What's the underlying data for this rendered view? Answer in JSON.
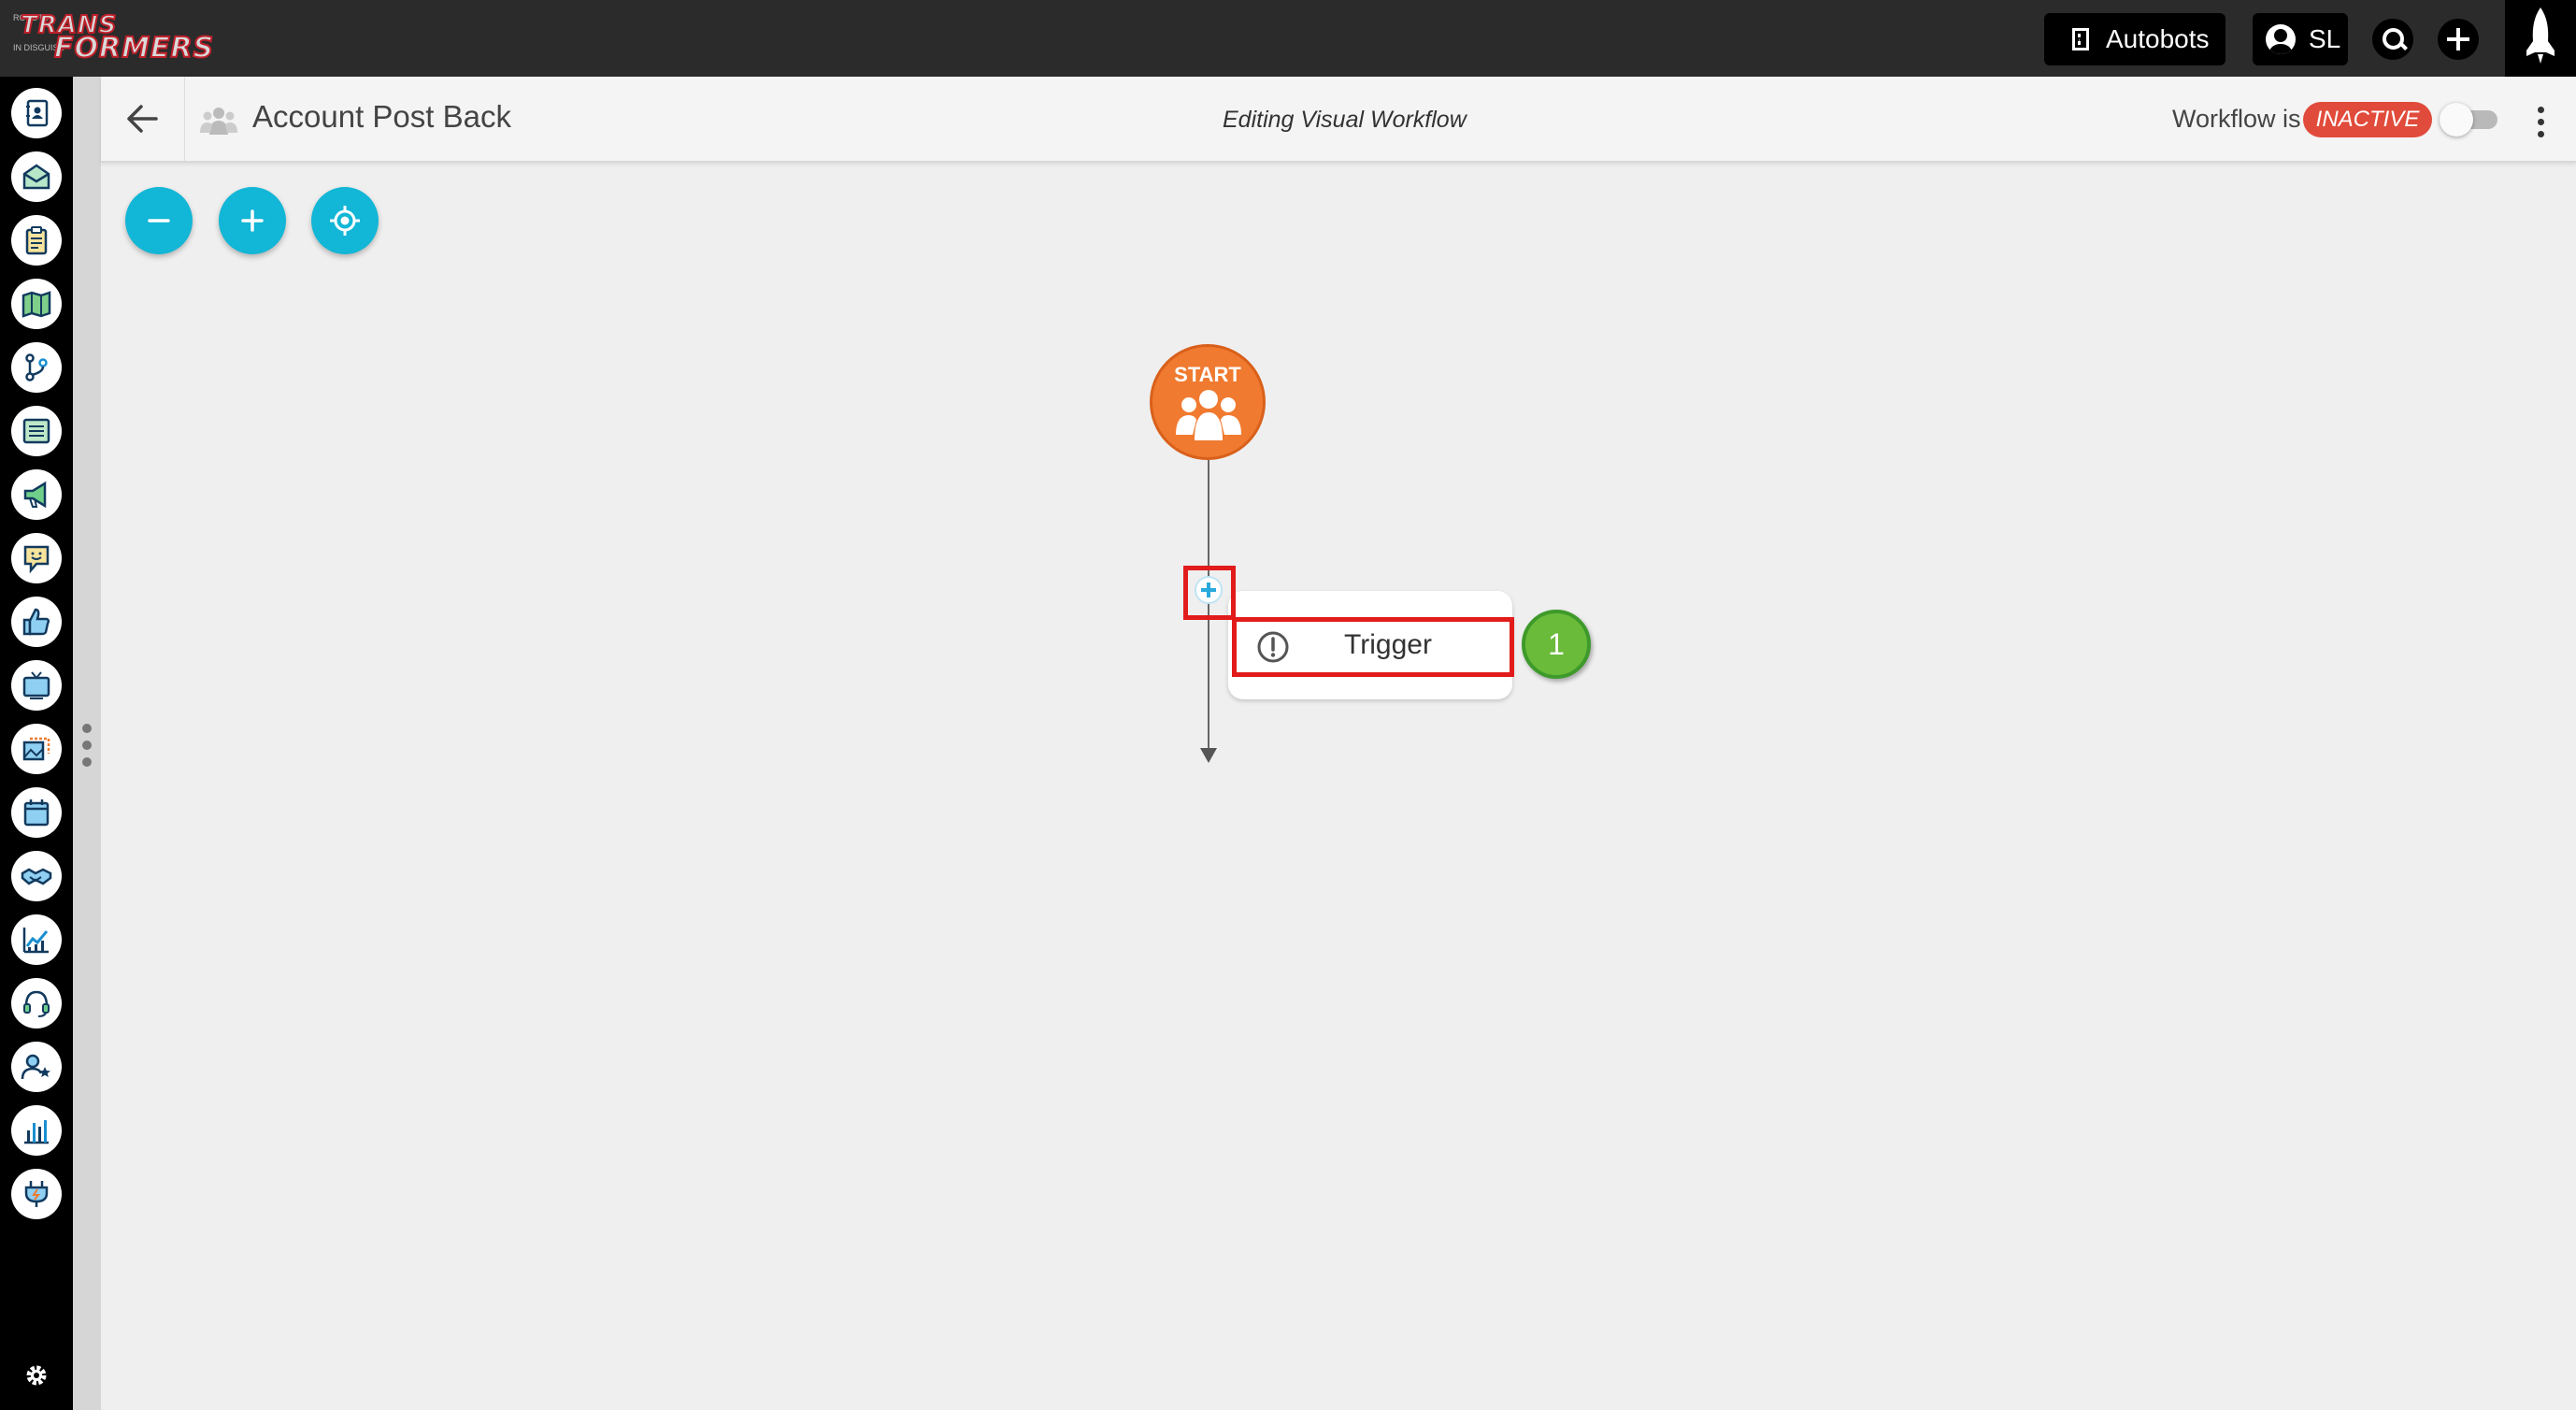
{
  "brand": {
    "logo_line1": "TRANS",
    "logo_line2": "FORMERS",
    "logo_small1": "ROBOTS",
    "logo_small2": "IN DISGUISE"
  },
  "topbar": {
    "org_label": "Autobots",
    "user_initials": "SL",
    "icons": [
      "building-icon",
      "user-avatar-icon",
      "search-icon",
      "plus-icon",
      "rocket-icon"
    ]
  },
  "sidebar": {
    "items": [
      {
        "name": "contacts",
        "icon": "contact-book-icon"
      },
      {
        "name": "inbox",
        "icon": "envelope-open-icon"
      },
      {
        "name": "tasks",
        "icon": "clipboard-icon"
      },
      {
        "name": "maps",
        "icon": "map-icon"
      },
      {
        "name": "workflows",
        "icon": "branch-icon"
      },
      {
        "name": "lists",
        "icon": "list-icon"
      },
      {
        "name": "campaigns",
        "icon": "megaphone-icon"
      },
      {
        "name": "chat",
        "icon": "chat-bubble-icon"
      },
      {
        "name": "social",
        "icon": "thumbs-up-icon"
      },
      {
        "name": "media",
        "icon": "tv-icon"
      },
      {
        "name": "content",
        "icon": "image-gallery-icon"
      },
      {
        "name": "calendar",
        "icon": "calendar-icon"
      },
      {
        "name": "deals",
        "icon": "handshake-icon"
      },
      {
        "name": "analytics",
        "icon": "trend-chart-icon"
      },
      {
        "name": "support",
        "icon": "headset-icon"
      },
      {
        "name": "users",
        "icon": "user-star-icon"
      },
      {
        "name": "reports",
        "icon": "bar-chart-icon"
      },
      {
        "name": "integrations",
        "icon": "plug-icon"
      }
    ],
    "footer_icon": "gear-icon"
  },
  "header": {
    "title": "Account Post Back",
    "mode": "Editing Visual Workflow",
    "status_prefix": "Workflow is",
    "status": "INACTIVE",
    "toggle_on": false
  },
  "canvas": {
    "controls": [
      "zoom-out",
      "zoom-in",
      "recenter"
    ],
    "start_label": "START",
    "trigger_label": "Trigger",
    "step_number": "1"
  },
  "colors": {
    "accent": "#12b6d6",
    "start": "#f07a30",
    "inactive": "#e14b3b",
    "step_badge": "#6bbb3a",
    "highlight": "#e21b1b"
  }
}
